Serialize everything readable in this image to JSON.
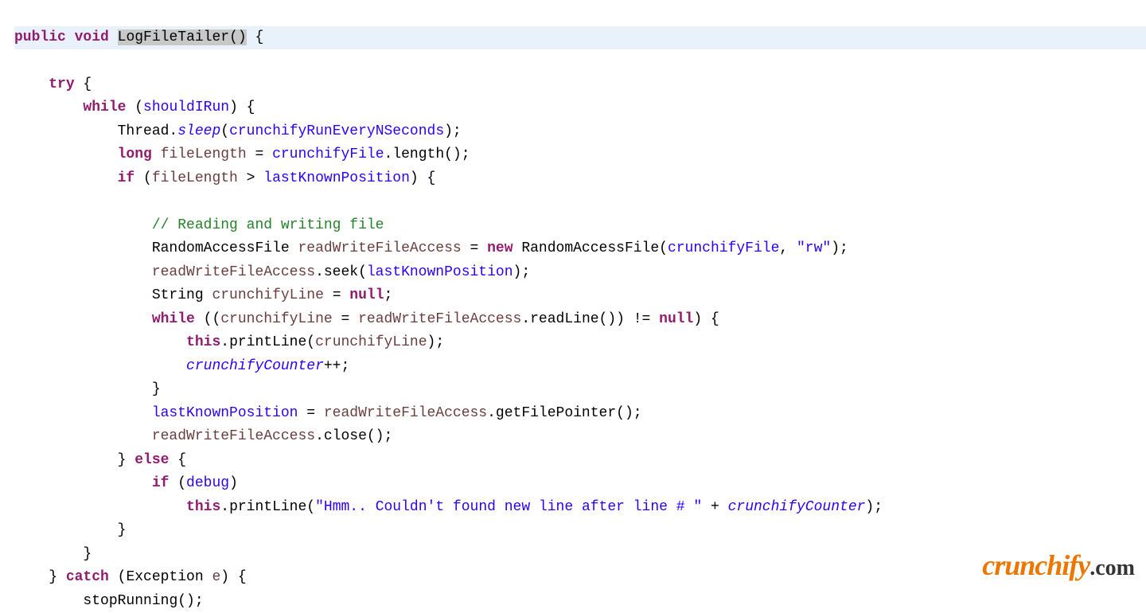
{
  "code": {
    "l1": {
      "k1": "public",
      "k2": "void",
      "name": "LogFileTailer",
      "parens": "()",
      "brace": " {"
    },
    "l2": {
      "k1": "try",
      "rest": " {"
    },
    "l3": {
      "k1": "while",
      "open": " (",
      "cond": "shouldIRun",
      "close": ") {"
    },
    "l4": {
      "cls": "Thread.",
      "m": "sleep",
      "open": "(",
      "arg": "crunchifyRunEveryNSeconds",
      "close": ");"
    },
    "l5": {
      "k1": "long",
      "var": " fileLength",
      "eq": " = ",
      "obj": "crunchifyFile",
      "call": ".length();"
    },
    "l6": {
      "k1": "if",
      "open": " (",
      "v1": "fileLength",
      "op": " > ",
      "v2": "lastKnownPosition",
      "close": ") {"
    },
    "l7": {
      "comment": "// Reading and writing file"
    },
    "l8": {
      "cls": "RandomAccessFile ",
      "var": "readWriteFileAccess",
      "eq": " = ",
      "kw": "new",
      "ctor": " RandomAccessFile(",
      "arg1": "crunchifyFile",
      "sep": ", ",
      "str": "\"rw\"",
      "close": ");"
    },
    "l9": {
      "obj": "readWriteFileAccess",
      "call": ".seek(",
      "arg": "lastKnownPosition",
      "close": ");"
    },
    "l10": {
      "cls": "String ",
      "var": "crunchifyLine",
      "eq": " = ",
      "kw": "null",
      "end": ";"
    },
    "l11": {
      "k1": "while",
      "open": " ((",
      "v1": "crunchifyLine",
      "eq": " = ",
      "obj": "readWriteFileAccess",
      "call": ".readLine()) != ",
      "kw2": "null",
      "close": ") {"
    },
    "l12": {
      "kw": "this",
      "call": ".printLine(",
      "arg": "crunchifyLine",
      "close": ");"
    },
    "l13": {
      "var": "crunchifyCounter",
      "op": "++;"
    },
    "l14": {
      "brace": "}"
    },
    "l15": {
      "v1": "lastKnownPosition",
      "eq": " = ",
      "obj": "readWriteFileAccess",
      "call": ".getFilePointer();"
    },
    "l16": {
      "obj": "readWriteFileAccess",
      "call": ".close();"
    },
    "l17": {
      "brace": "} ",
      "kw": "else",
      "rest": " {"
    },
    "l18": {
      "kw": "if",
      "open": " (",
      "cond": "debug",
      "close": ")"
    },
    "l19": {
      "kw": "this",
      "call": ".printLine(",
      "str": "\"Hmm.. Couldn't found new line after line # \"",
      "plus": " + ",
      "var": "crunchifyCounter",
      "close": ");"
    },
    "l20": {
      "brace": "}"
    },
    "l21": {
      "brace": "}"
    },
    "l22": {
      "brace": "} ",
      "kw": "catch",
      "open": " (Exception ",
      "var": "e",
      "close": ") {"
    },
    "l23": {
      "call": "stopRunning();"
    }
  },
  "watermark": {
    "brand": "crunchify",
    "dotcom": ".com"
  }
}
